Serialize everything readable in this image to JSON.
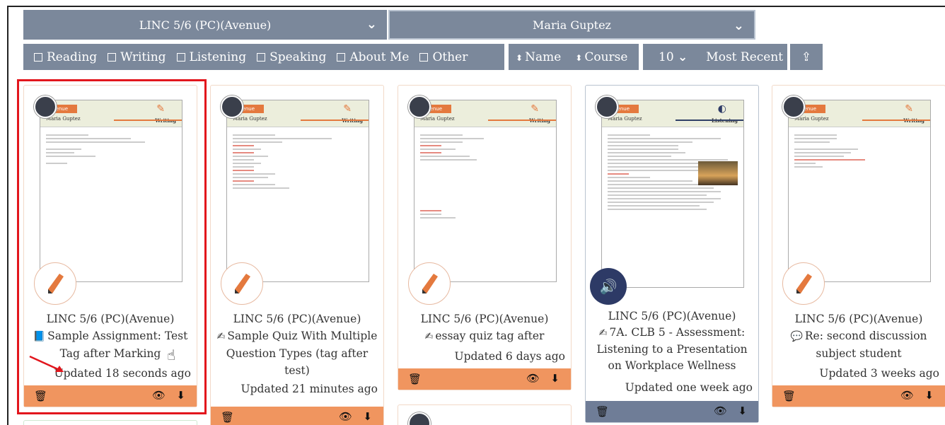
{
  "filters": {
    "course_select": "LINC 5/6 (PC)(Avenue)",
    "student_select": "Maria Guptez",
    "skills": [
      "Reading",
      "Writing",
      "Listening",
      "Speaking",
      "About Me",
      "Other"
    ],
    "sort_name": "Name",
    "sort_course": "Course",
    "per_page": "10",
    "order": "Most Recent"
  },
  "icons": {
    "chevron": "chevron-down-icon",
    "upload": "upload-icon",
    "trash": "trash-icon",
    "view": "eye-icon",
    "download": "download-icon"
  },
  "thumbnail": {
    "tag": "Avenue",
    "student": "Maria Guptez",
    "skill_writing": "Writing",
    "skill_listening": "Listening"
  },
  "cards": [
    {
      "course": "LINC 5/6 (PC)(Avenue)",
      "title": "Sample Assignment: Test Tag after Marking",
      "type_icon": "assignment-icon",
      "updated": "Updated 18 seconds ago",
      "skill": "writing"
    },
    {
      "course": "LINC 5/6 (PC)(Avenue)",
      "title": "Sample Quiz With Multiple Question Types (tag after test)",
      "type_icon": "quiz-icon",
      "updated": "Updated 21 minutes ago",
      "skill": "writing"
    },
    {
      "course": "LINC 5/6 (PC)(Avenue)",
      "title": "essay quiz tag after",
      "type_icon": "quiz-icon",
      "updated": "Updated 6 days ago",
      "skill": "writing"
    },
    {
      "course": "LINC 5/6 (PC)(Avenue)",
      "title": "7A. CLB 5 - Assessment: Listening to a Presentation on Workplace Wellness",
      "type_icon": "quiz-icon",
      "updated": "Updated one week ago",
      "skill": "listening"
    },
    {
      "course": "LINC 5/6 (PC)(Avenue)",
      "title": "Re: second discussion subject student",
      "type_icon": "discussion-icon",
      "updated": "Updated 3 weeks ago",
      "skill": "writing"
    }
  ],
  "colors": {
    "accent": "#f0955f",
    "listening": "#6f7d97",
    "highlight": "#e2161d",
    "bar": "#7b889b"
  }
}
